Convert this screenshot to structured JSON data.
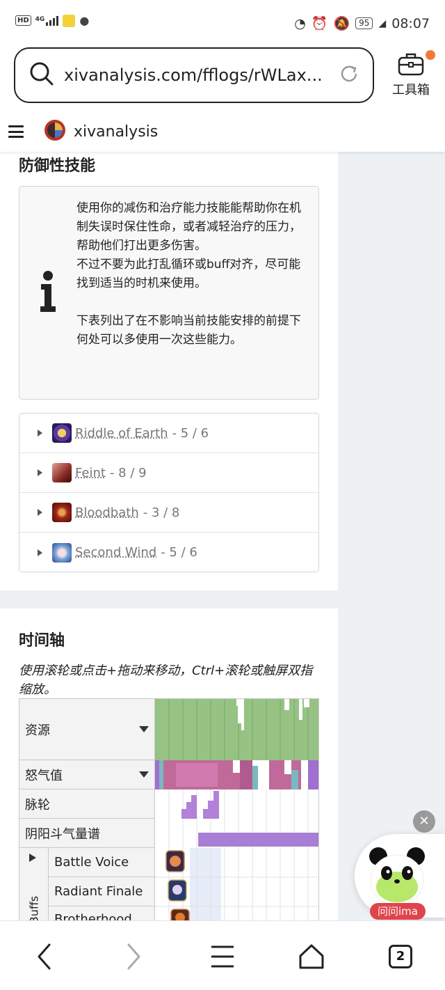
{
  "status_bar": {
    "left_labels": [
      "HD",
      "4G"
    ],
    "battery": "95",
    "time": "08:07"
  },
  "browser": {
    "url": "xivanalysis.com/fflogs/rWLax...",
    "toolbox_label": "工具箱"
  },
  "app": {
    "brand": "xivanalysis"
  },
  "defensives": {
    "title": "防御性技能",
    "info_line1": "使用你的减伤和治疗能力技能能帮助你在机制失误时保住性命，或者减轻治疗的压力，帮助他们打出更多伤害。",
    "info_line2": "不过不要为此打乱循环或buff对齐，尽可能找到适当的时机来使用。",
    "info_line3": "下表列出了在不影响当前技能安排的前提下何处可以多使用一次这些能力。",
    "skills": [
      {
        "name": "Riddle of Earth",
        "count": "- 5 / 6",
        "color": "#3a2a8a"
      },
      {
        "name": "Feint",
        "count": "- 8 / 9",
        "color": "#8a2a24"
      },
      {
        "name": "Bloodbath",
        "count": "- 3 / 8",
        "color": "#7a1d12"
      },
      {
        "name": "Second Wind",
        "count": "- 5 / 6",
        "color": "#4a74b8"
      }
    ]
  },
  "timeline": {
    "title": "时间轴",
    "hint": "使用滚轮或点击+拖动来移动，Ctrl+滚轮或触屏双指缩放。",
    "rows": {
      "resources": "资源",
      "rage": "怒气值",
      "chakra": "脉轮",
      "yinyang": "阴阳斗气量谱"
    },
    "group_label": "d Buffs",
    "buffs": [
      "Battle Voice",
      "Radiant Finale",
      "Brotherhood"
    ]
  },
  "floating": {
    "close_symbol": "✕",
    "assistant_label": "问问ima"
  },
  "bottom_nav": {
    "tabs_count": "2"
  },
  "colors": {
    "resource_green": "#96c284",
    "rage_magenta": "#c06a9a",
    "chakra_purple": "#b182d8",
    "yinyang_purple": "#a77fd6",
    "link_gray": "#777777"
  }
}
